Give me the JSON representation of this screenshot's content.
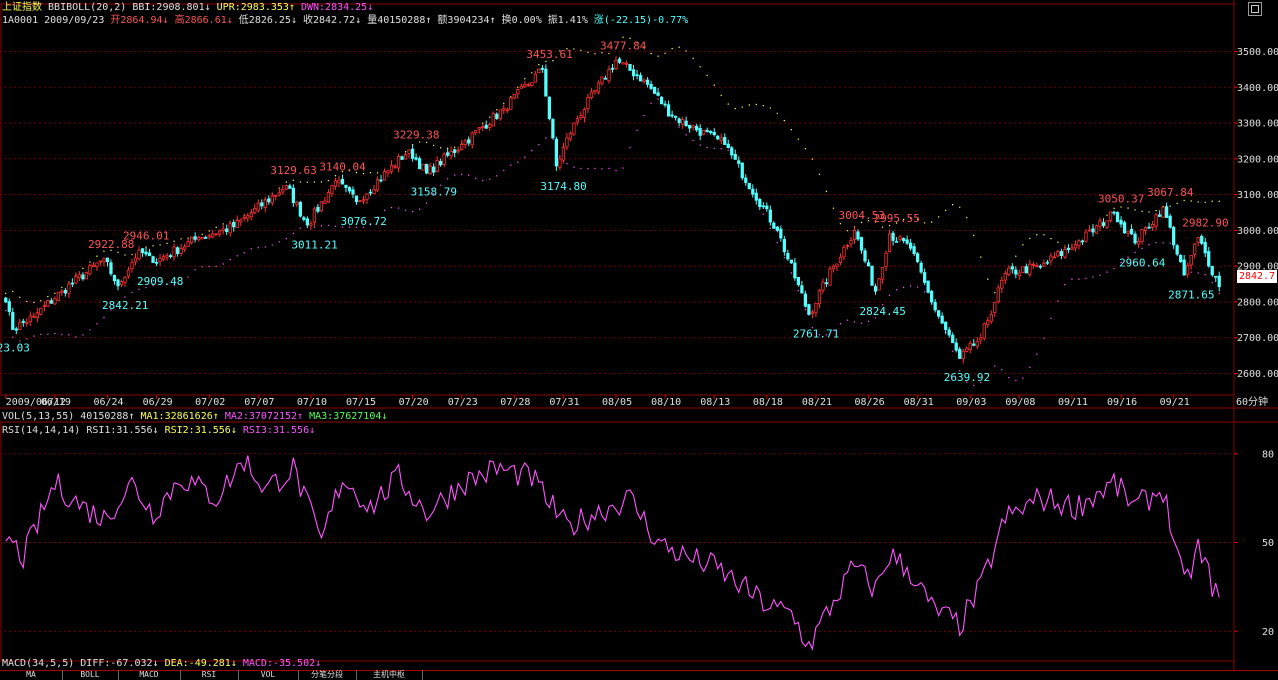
{
  "window": {
    "index_name": "上证指数",
    "indicator_code": "BBIBOLL(20,2)"
  },
  "header_line1": {
    "bbi_label": "BBI:2908.801↓",
    "upr_label": "UPR:2983.353↑",
    "dwn_label": "DWN:2834.25↓"
  },
  "header_line2": {
    "code_date": "1A0001 2009/09/23",
    "open": "开2864.94↓",
    "high": "高2866.61↓",
    "low": "低2826.25↓",
    "close": "收2842.72↓",
    "volume": "量40150288↑",
    "amount": "额3904234↑",
    "turnover": "换0.00%",
    "amplitude": "振1.41%",
    "change": "涨(-22.15)-0.77%"
  },
  "current_price_tag": "2842.7",
  "period_label": "60分钟",
  "vol_header": {
    "params": "VOL(5,13,55)",
    "value": "40150288↑",
    "ma1": "MA1:32861626↑",
    "ma2": "MA2:37072152↑",
    "ma3": "MA3:37627104↓"
  },
  "rsi_header": {
    "params": "RSI(14,14,14)",
    "rsi1": "RSI1:31.556↓",
    "rsi2": "RSI2:31.556↓",
    "rsi3": "RSI3:31.556↓"
  },
  "macd_header": {
    "params": "MACD(34,5,5)",
    "diff": "DIFF:-67.032↓",
    "dea": "DEA:-49.281↓",
    "macd": "MACD:-35.502↓"
  },
  "tabs": [
    "MA",
    "BOLL",
    "MACD",
    "RSI",
    "VOL",
    "分笔分段",
    "主机中枢"
  ],
  "colors": {
    "grid": "#8b0000",
    "up_candle": "#ff3030",
    "down_candle": "#54ffff",
    "bands": "#ffff54",
    "lower_band": "#ff54ff",
    "rsi_line": "#ff54ff",
    "high_label": "#ff5454",
    "low_label": "#54ffff"
  },
  "chart_data": [
    {
      "type": "candlestick",
      "title": "上证指数 BBIBOLL(20,2)",
      "ylim": [
        2540,
        3560
      ],
      "y_ticks": [
        2600,
        2700,
        2800,
        2900,
        3000,
        3100,
        3200,
        3300,
        3400,
        3500
      ],
      "x_ticks": [
        "2009/06/12",
        "06/19",
        "06/24",
        "06/29",
        "07/02",
        "07/07",
        "07/10",
        "07/15",
        "07/20",
        "07/23",
        "07/28",
        "07/31",
        "08/05",
        "08/10",
        "08/13",
        "08/18",
        "08/21",
        "08/26",
        "08/31",
        "09/03",
        "09/08",
        "09/11",
        "09/16",
        "09/21"
      ],
      "annotations": [
        {
          "label": "23.03",
          "x_index": 2,
          "value": 2723.03,
          "kind": "low"
        },
        {
          "label": "2922.88",
          "x_index": 28,
          "value": 2922.88,
          "kind": "high"
        },
        {
          "label": "2842.21",
          "x_index": 32,
          "value": 2842.21,
          "kind": "low"
        },
        {
          "label": "2946.01",
          "x_index": 38,
          "value": 2946.01,
          "kind": "high"
        },
        {
          "label": "2909.48",
          "x_index": 42,
          "value": 2909.48,
          "kind": "low"
        },
        {
          "label": "3129.63",
          "x_index": 80,
          "value": 3129.63,
          "kind": "high"
        },
        {
          "label": "3011.21",
          "x_index": 86,
          "value": 3011.21,
          "kind": "low"
        },
        {
          "label": "3140.04",
          "x_index": 94,
          "value": 3140.04,
          "kind": "high"
        },
        {
          "label": "3076.72",
          "x_index": 100,
          "value": 3076.72,
          "kind": "low"
        },
        {
          "label": "3229.38",
          "x_index": 115,
          "value": 3229.38,
          "kind": "high"
        },
        {
          "label": "3158.79",
          "x_index": 120,
          "value": 3158.79,
          "kind": "low"
        },
        {
          "label": "3453.61",
          "x_index": 153,
          "value": 3453.61,
          "kind": "high"
        },
        {
          "label": "3174.80",
          "x_index": 157,
          "value": 3174.8,
          "kind": "low"
        },
        {
          "label": "3477.84",
          "x_index": 174,
          "value": 3477.84,
          "kind": "high"
        },
        {
          "label": "2761.71",
          "x_index": 229,
          "value": 2761.71,
          "kind": "low"
        },
        {
          "label": "3004.53",
          "x_index": 242,
          "value": 3004.53,
          "kind": "high"
        },
        {
          "label": "2824.45",
          "x_index": 248,
          "value": 2824.45,
          "kind": "low"
        },
        {
          "label": "2995.55",
          "x_index": 252,
          "value": 2995.55,
          "kind": "high"
        },
        {
          "label": "2639.92",
          "x_index": 272,
          "value": 2639.92,
          "kind": "low"
        },
        {
          "label": "3050.37",
          "x_index": 316,
          "value": 3050.37,
          "kind": "high"
        },
        {
          "label": "2960.64",
          "x_index": 322,
          "value": 2960.64,
          "kind": "low"
        },
        {
          "label": "3067.84",
          "x_index": 330,
          "value": 3067.84,
          "kind": "high"
        },
        {
          "label": "2871.65",
          "x_index": 336,
          "value": 2871.65,
          "kind": "low"
        },
        {
          "label": "2982.90",
          "x_index": 340,
          "value": 2982.9,
          "kind": "high"
        }
      ],
      "anchors": [
        [
          0,
          2800
        ],
        [
          2,
          2723
        ],
        [
          8,
          2760
        ],
        [
          16,
          2830
        ],
        [
          28,
          2920
        ],
        [
          32,
          2845
        ],
        [
          38,
          2945
        ],
        [
          42,
          2910
        ],
        [
          55,
          2980
        ],
        [
          65,
          3010
        ],
        [
          80,
          3125
        ],
        [
          86,
          3015
        ],
        [
          94,
          3138
        ],
        [
          100,
          3080
        ],
        [
          115,
          3225
        ],
        [
          120,
          3160
        ],
        [
          130,
          3240
        ],
        [
          142,
          3340
        ],
        [
          153,
          3450
        ],
        [
          157,
          3180
        ],
        [
          162,
          3300
        ],
        [
          174,
          3475
        ],
        [
          182,
          3420
        ],
        [
          190,
          3320
        ],
        [
          205,
          3240
        ],
        [
          220,
          3000
        ],
        [
          229,
          2765
        ],
        [
          236,
          2900
        ],
        [
          242,
          3000
        ],
        [
          248,
          2830
        ],
        [
          252,
          2990
        ],
        [
          258,
          2950
        ],
        [
          264,
          2800
        ],
        [
          272,
          2642
        ],
        [
          278,
          2700
        ],
        [
          285,
          2880
        ],
        [
          295,
          2900
        ],
        [
          305,
          2960
        ],
        [
          316,
          3048
        ],
        [
          322,
          2965
        ],
        [
          330,
          3065
        ],
        [
          336,
          2875
        ],
        [
          340,
          2980
        ],
        [
          346,
          2843
        ]
      ],
      "last_close": 2842.72
    },
    {
      "type": "line",
      "title": "RSI(14,14,14)",
      "ylim": [
        12,
        86
      ],
      "y_ticks": [
        20,
        50,
        80
      ],
      "series": [
        {
          "name": "RSI1",
          "anchors": [
            [
              0,
              52
            ],
            [
              5,
              45
            ],
            [
              14,
              70
            ],
            [
              22,
              62
            ],
            [
              28,
              58
            ],
            [
              36,
              70
            ],
            [
              42,
              60
            ],
            [
              50,
              72
            ],
            [
              60,
              65
            ],
            [
              68,
              78
            ],
            [
              74,
              68
            ],
            [
              82,
              75
            ],
            [
              90,
              50
            ],
            [
              96,
              72
            ],
            [
              104,
              62
            ],
            [
              112,
              72
            ],
            [
              120,
              60
            ],
            [
              130,
              70
            ],
            [
              140,
              75
            ],
            [
              150,
              72
            ],
            [
              160,
              55
            ],
            [
              168,
              60
            ],
            [
              178,
              65
            ],
            [
              186,
              50
            ],
            [
              194,
              45
            ],
            [
              202,
              42
            ],
            [
              210,
              35
            ],
            [
              218,
              28
            ],
            [
              224,
              26
            ],
            [
              229,
              15
            ],
            [
              236,
              30
            ],
            [
              242,
              42
            ],
            [
              248,
              34
            ],
            [
              252,
              46
            ],
            [
              258,
              40
            ],
            [
              264,
              28
            ],
            [
              272,
              22
            ],
            [
              278,
              35
            ],
            [
              285,
              58
            ],
            [
              295,
              65
            ],
            [
              305,
              62
            ],
            [
              316,
              70
            ],
            [
              322,
              62
            ],
            [
              330,
              68
            ],
            [
              336,
              35
            ],
            [
              340,
              48
            ],
            [
              344,
              36
            ],
            [
              346,
              31.5
            ]
          ]
        }
      ]
    }
  ]
}
